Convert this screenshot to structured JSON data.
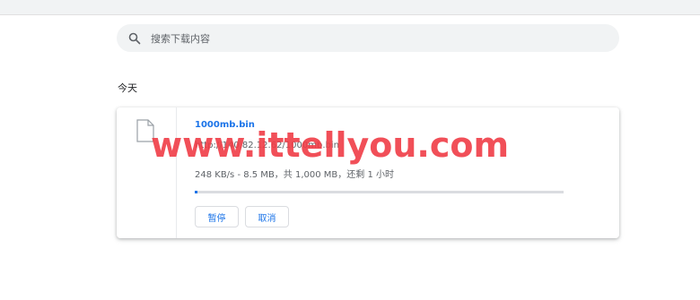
{
  "search": {
    "placeholder": "搜索下载内容",
    "icon": "search-icon"
  },
  "section": {
    "label": "今天"
  },
  "download": {
    "file_name": "1000mb.bin",
    "url": "http://140.82.12.62/1000mb.bin",
    "progress_text": "248 KB/s - 8.5 MB，共 1,000 MB，还剩 1 小时",
    "progress_fraction": 0.0085,
    "pause_label": "暂停",
    "cancel_label": "取消",
    "file_icon": "file-icon"
  },
  "watermark": {
    "text": "www.ittellyou.com"
  },
  "colors": {
    "accent": "#1a73e8",
    "watermark": "#f03c46",
    "search_bg": "#f1f3f4"
  }
}
